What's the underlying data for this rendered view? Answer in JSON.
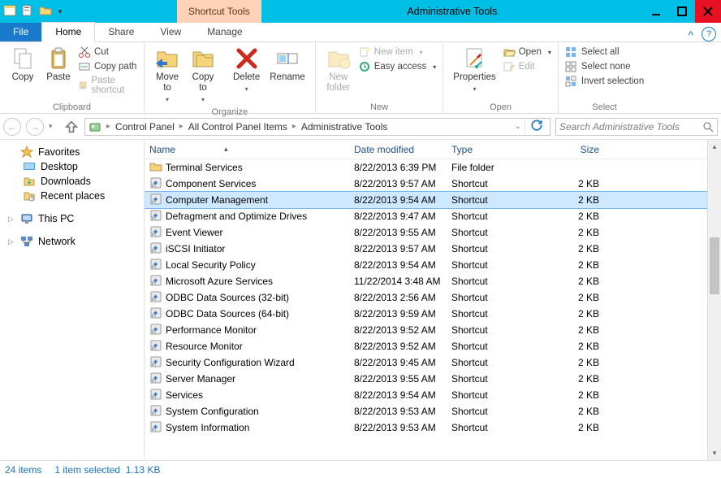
{
  "title": "Administrative Tools",
  "contextual_tab": "Shortcut Tools",
  "tabs": {
    "file": "File",
    "home": "Home",
    "share": "Share",
    "view": "View",
    "manage": "Manage"
  },
  "ribbon": {
    "clipboard": {
      "label": "Clipboard",
      "copy": "Copy",
      "paste": "Paste",
      "cut": "Cut",
      "copy_path": "Copy path",
      "paste_shortcut": "Paste shortcut"
    },
    "organize": {
      "label": "Organize",
      "move_to": "Move\nto",
      "copy_to": "Copy\nto",
      "delete": "Delete",
      "rename": "Rename"
    },
    "new": {
      "label": "New",
      "new_folder": "New\nfolder",
      "new_item": "New item",
      "easy_access": "Easy access"
    },
    "open": {
      "label": "Open",
      "properties": "Properties",
      "open": "Open",
      "edit": "Edit"
    },
    "select": {
      "label": "Select",
      "select_all": "Select all",
      "select_none": "Select none",
      "invert": "Invert selection"
    }
  },
  "nav": {
    "crumbs": [
      "Control Panel",
      "All Control Panel Items",
      "Administrative Tools"
    ],
    "search_placeholder": "Search Administrative Tools"
  },
  "navpane": {
    "favorites": {
      "label": "Favorites",
      "items": [
        "Desktop",
        "Downloads",
        "Recent places"
      ]
    },
    "this_pc": "This PC",
    "network": "Network"
  },
  "columns": {
    "name": "Name",
    "date": "Date modified",
    "type": "Type",
    "size": "Size"
  },
  "rows": [
    {
      "icon": "folder",
      "name": "Terminal Services",
      "date": "8/22/2013 6:39 PM",
      "type": "File folder",
      "size": ""
    },
    {
      "icon": "shortcut",
      "name": "Component Services",
      "date": "8/22/2013 9:57 AM",
      "type": "Shortcut",
      "size": "2 KB"
    },
    {
      "icon": "shortcut",
      "name": "Computer Management",
      "date": "8/22/2013 9:54 AM",
      "type": "Shortcut",
      "size": "2 KB",
      "selected": true
    },
    {
      "icon": "shortcut",
      "name": "Defragment and Optimize Drives",
      "date": "8/22/2013 9:47 AM",
      "type": "Shortcut",
      "size": "2 KB"
    },
    {
      "icon": "shortcut",
      "name": "Event Viewer",
      "date": "8/22/2013 9:55 AM",
      "type": "Shortcut",
      "size": "2 KB"
    },
    {
      "icon": "shortcut",
      "name": "iSCSI Initiator",
      "date": "8/22/2013 9:57 AM",
      "type": "Shortcut",
      "size": "2 KB"
    },
    {
      "icon": "shortcut",
      "name": "Local Security Policy",
      "date": "8/22/2013 9:54 AM",
      "type": "Shortcut",
      "size": "2 KB"
    },
    {
      "icon": "shortcut",
      "name": "Microsoft Azure Services",
      "date": "11/22/2014 3:48 AM",
      "type": "Shortcut",
      "size": "2 KB"
    },
    {
      "icon": "shortcut",
      "name": "ODBC Data Sources (32-bit)",
      "date": "8/22/2013 2:56 AM",
      "type": "Shortcut",
      "size": "2 KB"
    },
    {
      "icon": "shortcut",
      "name": "ODBC Data Sources (64-bit)",
      "date": "8/22/2013 9:59 AM",
      "type": "Shortcut",
      "size": "2 KB"
    },
    {
      "icon": "shortcut",
      "name": "Performance Monitor",
      "date": "8/22/2013 9:52 AM",
      "type": "Shortcut",
      "size": "2 KB"
    },
    {
      "icon": "shortcut",
      "name": "Resource Monitor",
      "date": "8/22/2013 9:52 AM",
      "type": "Shortcut",
      "size": "2 KB"
    },
    {
      "icon": "shortcut",
      "name": "Security Configuration Wizard",
      "date": "8/22/2013 9:45 AM",
      "type": "Shortcut",
      "size": "2 KB"
    },
    {
      "icon": "shortcut",
      "name": "Server Manager",
      "date": "8/22/2013 9:55 AM",
      "type": "Shortcut",
      "size": "2 KB"
    },
    {
      "icon": "shortcut",
      "name": "Services",
      "date": "8/22/2013 9:54 AM",
      "type": "Shortcut",
      "size": "2 KB"
    },
    {
      "icon": "shortcut",
      "name": "System Configuration",
      "date": "8/22/2013 9:53 AM",
      "type": "Shortcut",
      "size": "2 KB"
    },
    {
      "icon": "shortcut",
      "name": "System Information",
      "date": "8/22/2013 9:53 AM",
      "type": "Shortcut",
      "size": "2 KB"
    }
  ],
  "status": {
    "count": "24 items",
    "selection": "1 item selected",
    "size": "1.13 KB"
  }
}
